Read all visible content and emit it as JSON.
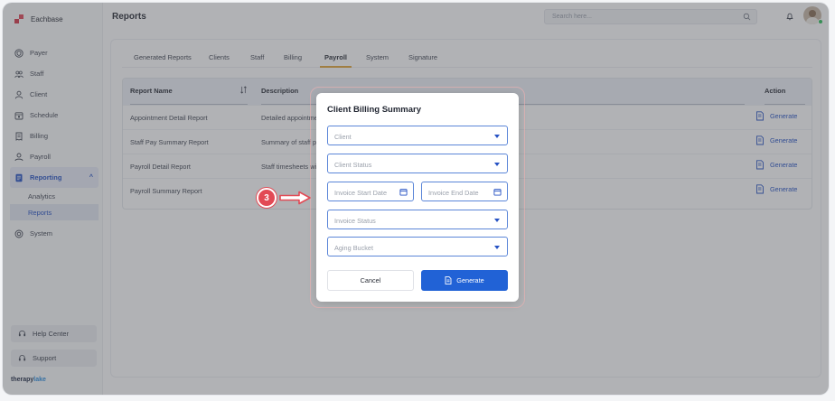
{
  "app": {
    "name": "Eachbase"
  },
  "sidebar": {
    "items": [
      {
        "label": "Payer",
        "icon": "shield-icon"
      },
      {
        "label": "Staff",
        "icon": "group-icon"
      },
      {
        "label": "Client",
        "icon": "user-icon"
      },
      {
        "label": "Schedule",
        "icon": "calendar-icon"
      },
      {
        "label": "Billing",
        "icon": "receipt-icon"
      },
      {
        "label": "Payroll",
        "icon": "money-icon"
      },
      {
        "label": "Reporting",
        "icon": "report-icon",
        "active": true
      },
      {
        "label": "System",
        "icon": "gear-icon"
      }
    ],
    "sub_items": [
      {
        "label": "Analytics"
      },
      {
        "label": "Reports",
        "active": true
      }
    ],
    "help_label": "Help Center",
    "support_label": "Support",
    "footer_brand_a": "therapy",
    "footer_brand_b": "lake"
  },
  "header": {
    "title": "Reports",
    "search_placeholder": "Search here..."
  },
  "tabs": [
    {
      "label": "Generated Reports"
    },
    {
      "label": "Clients"
    },
    {
      "label": "Staff"
    },
    {
      "label": "Billing"
    },
    {
      "label": "Payroll",
      "active": true
    },
    {
      "label": "System"
    },
    {
      "label": "Signature"
    }
  ],
  "table": {
    "columns": {
      "name": "Report Name",
      "description": "Description",
      "action": "Action"
    },
    "rows": [
      {
        "name": "Appointment Detail Report",
        "description": "Detailed appointmen",
        "action": "Generate"
      },
      {
        "name": "Staff Pay Summary Report",
        "description": "Summary of staff pa",
        "action": "Generate"
      },
      {
        "name": "Payroll Detail Report",
        "description": "Staff timesheets with",
        "action": "Generate"
      },
      {
        "name": "Payroll Summary Report",
        "description": "",
        "action": "Generate"
      }
    ]
  },
  "modal": {
    "title": "Client Billing Summary",
    "fields": {
      "client": "Client",
      "client_status": "Client Status",
      "invoice_start": "Invoice Start Date",
      "invoice_end": "Invoice End Date",
      "invoice_status": "Invoice Status",
      "aging_bucket": "Aging Bucket"
    },
    "cancel_label": "Cancel",
    "generate_label": "Generate"
  },
  "annotation": {
    "step": "3"
  },
  "colors": {
    "accent": "#2162d6",
    "tab_underline": "#e2a63a",
    "annotation": "#e24a55",
    "brand": "#d63a4a"
  }
}
